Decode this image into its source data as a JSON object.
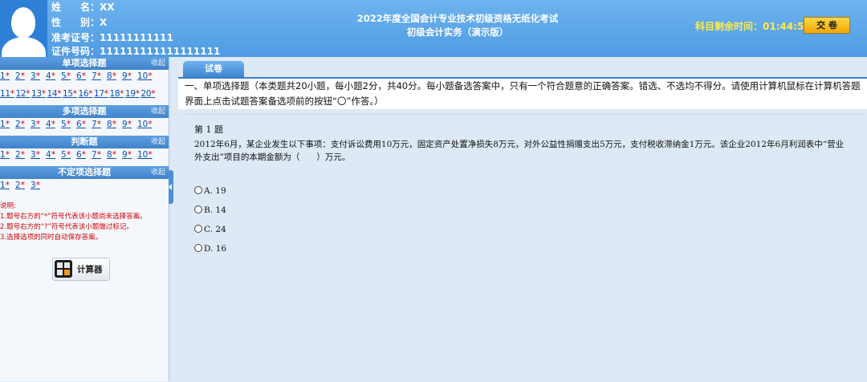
{
  "header": {
    "name_label": "姓　　名：",
    "name_value": "XX",
    "gender_label": "性　　别：",
    "gender_value": "X",
    "ticket_label": "准考证号：",
    "ticket_value": "11111111111",
    "id_label": "证件号码：",
    "id_value": "111111111111111111",
    "exam_title_line1": "2022年度全国会计专业技术初级资格无纸化考试",
    "exam_title_line2": "初级会计实务（演示版）",
    "timer_label": "科目剩余时间：",
    "timer_value": "01:44:55",
    "submit_label": "交 卷"
  },
  "sidebar": {
    "sections": [
      {
        "title": "单项选择题",
        "collapse": "收起",
        "rows": [
          [
            "1",
            "2",
            "3",
            "4",
            "5",
            "6",
            "7",
            "8",
            "9",
            "10"
          ],
          [
            "11",
            "12",
            "13",
            "14",
            "15",
            "16",
            "17",
            "18",
            "19",
            "20"
          ]
        ]
      },
      {
        "title": "多项选择题",
        "collapse": "收起",
        "rows": [
          [
            "1",
            "2",
            "3",
            "4",
            "5",
            "6",
            "7",
            "8",
            "9",
            "10"
          ]
        ]
      },
      {
        "title": "判断题",
        "collapse": "收起",
        "rows": [
          [
            "1",
            "2",
            "3",
            "4",
            "5",
            "6",
            "7",
            "8",
            "9",
            "10"
          ]
        ]
      },
      {
        "title": "不定项选择题",
        "collapse": "收起",
        "rows": [
          [
            "1",
            "2",
            "3"
          ]
        ]
      }
    ],
    "mark": "*",
    "notes_title": "说明:",
    "notes": [
      "1.题号右方的“*”符号代表该小题尚未选择答案。",
      "2.题号右方的“?”符号代表该小题做过标记。",
      "3.选择选项的同时自动保存答案。"
    ],
    "calculator_label": "计算器"
  },
  "main": {
    "tab_label": "试卷",
    "instructions": "一、单项选择题（本类题共20小题，每小题2分，共40分。每小题备选答案中，只有一个符合题意的正确答案。错选、不选均不得分。请使用计算机鼠标在计算机答题界面上点击试题答案备选项前的按钮“〇”作答。）",
    "question_label": "第 1 题",
    "question_text": "2012年6月，某企业发生以下事项：支付诉讼费用10万元，固定资产处置净损失8万元，对外公益性捐赠支出5万元，支付税收滞纳金1万元。该企业2012年6月利润表中“营业外支出”项目的本期金额为（　　）万元。",
    "options": [
      {
        "letter": "A.",
        "value": "19"
      },
      {
        "letter": "B.",
        "value": "14"
      },
      {
        "letter": "C.",
        "value": "24"
      },
      {
        "letter": "D.",
        "value": "16"
      }
    ]
  },
  "colors": {
    "header_blue": "#4f9be3",
    "accent_blue": "#3a7ec8",
    "timer_yellow": "#ffe94a",
    "mark_red": "#d40000",
    "link_blue": "#0b4fb4"
  }
}
